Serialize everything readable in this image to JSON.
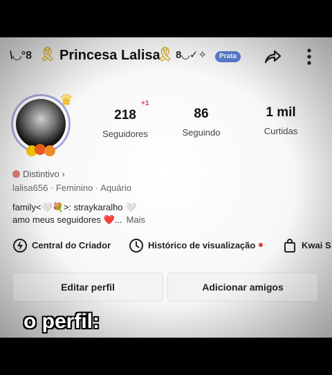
{
  "header": {
    "deco_left": "\\◡°8",
    "ribbon": "🎗",
    "name": "Princesa Lalisa",
    "deco_right": "8◡✓✧",
    "badge": "Prata",
    "share_icon": "share-arrow-icon",
    "more_icon": "more-vertical-icon"
  },
  "profile": {
    "new_followers": "+1",
    "stats": [
      {
        "value": "218",
        "label": "Seguidores"
      },
      {
        "value": "86",
        "label": "Seguindo"
      },
      {
        "value": "1 mil",
        "label": "Curtidas"
      }
    ],
    "distintivo": "Distintivo ›",
    "meta": "lalisa656  ·  Feminino  ·  Aquário",
    "bio_line1": "family<🤍💐>: straykaralho 🤍",
    "bio_line2": "amo meus seguidores ❤️...",
    "bio_more": "Mais"
  },
  "links": {
    "creator": "Central do Criador",
    "history": "Histórico de visualização",
    "shop": "Kwai S"
  },
  "buttons": {
    "edit": "Editar perfil",
    "add_friends": "Adicionar amigos"
  },
  "caption": "o perfil:"
}
